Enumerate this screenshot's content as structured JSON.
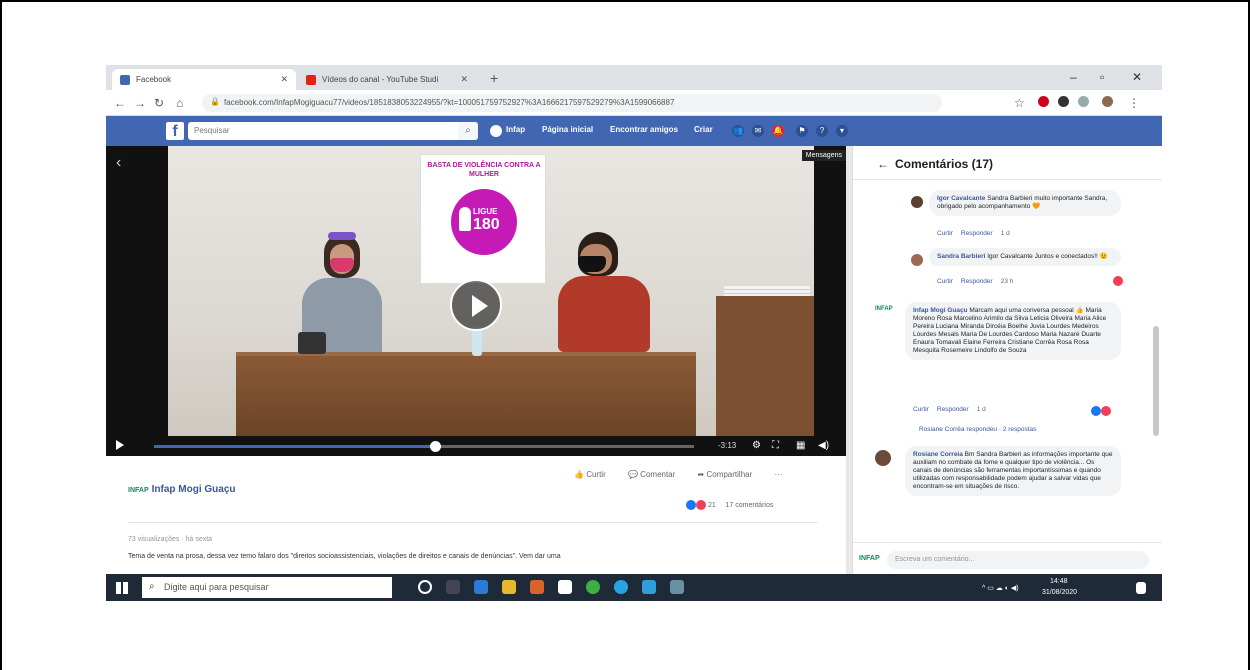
{
  "browser": {
    "tabs": [
      {
        "label": "Facebook"
      },
      {
        "label": "Vídeos do canal - YouTube Studi"
      }
    ],
    "new_tab": "+",
    "url": "facebook.com/InfapMogiguacu77/videos/1851838053224955/?kt=100051759752927%3A1666217597529279%3A1599066887"
  },
  "facebook": {
    "logo": "f",
    "search_placeholder": "Pesquisar",
    "nav": [
      "Infap",
      "Página inicial",
      "Encontrar amigos",
      "Criar"
    ]
  },
  "video": {
    "messenger_label": "Mensagens",
    "poster_title": "BASTA DE VIOLÊNCIA CONTRA A MULHER",
    "poster_line1": "LIGUE",
    "poster_line2": "180",
    "time_remaining": "-3:13",
    "progress": 0.52
  },
  "post": {
    "page_name": "Infap Mogi Guaçu",
    "page_logo": "INFAP",
    "actions": [
      "Curtir",
      "Comentar",
      "Compartilhar",
      "···"
    ],
    "reaction_count": "21",
    "comment_count": "17 comentários",
    "views": "73 visualizações · há sexta",
    "description": "Tema de venta na prosa, dessa vez temo falaro dos \"direitos socioassistenciais, violações de direitos e canais de denúncias\". Vem dar uma"
  },
  "comments_panel": {
    "title": "Comentários (17)",
    "comments": [
      {
        "author": "Igor Cavalcante",
        "text": "Sandra Barbieri muito importante Sandra, obrigado pelo acompanhamento 🧡",
        "meta": [
          "Curtir",
          "Responder",
          "1 d"
        ]
      },
      {
        "author": "Sandra Barbieri",
        "text": "Igor Cavalcante Juntos e conectados!! 😉",
        "meta": [
          "Curtir",
          "Responder",
          "23 h"
        ]
      },
      {
        "author": "Infap Mogi Guaçu",
        "text": "Marcam aqui uma conversa pessoal 👍 Maria Moreno Rosa Marcelino Arimilo da Silva Leticia Oliveira Maria Alice Pereira Luciana Miranda Dircéia Boelhe Juvia Lourdes Medeiros Lourdes Mesals Maria De Lourdes Cardoso Maria Nazaré Duarte Enaura Tomavali Elaine Ferreira Cristiane Corrêa Rosa Rosa Mesquita Rosemeire Lindolfo de Souza",
        "meta": [
          "Curtir",
          "Responder",
          "1 d"
        ]
      },
      {
        "author": "Rosiane Correia",
        "text": "Bm Sandra Barbieri as informações importante que auxiliam no combate da fome e qualquer tipo de violência... Os canais de denúncias são ferramentas importantíssimas e quando utilizadas com responsabilidade podem ajudar a salvar vidas que encontram-se em situações de risco.",
        "meta": []
      }
    ],
    "replies_link": "Rosiane Corrêa respondeu · 2 respostas",
    "composer_placeholder": "Escreva um comentário...",
    "composer_logo": "INFAP"
  },
  "taskbar": {
    "search_placeholder": "Digite aqui para pesquisar",
    "time": "14:48",
    "date": "31/08/2020"
  },
  "colors": {
    "fb_blue": "#4267b2",
    "poster_magenta": "#c51ab5",
    "taskbar": "#1f2a38"
  }
}
